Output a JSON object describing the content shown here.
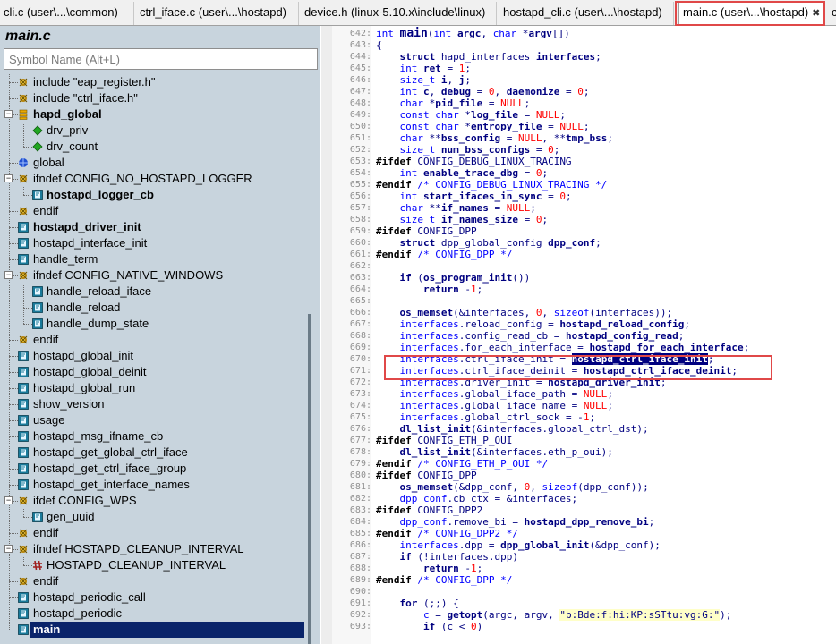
{
  "tabs": [
    {
      "label": "cli.c (user\\...\\common)",
      "active": false
    },
    {
      "label": "ctrl_iface.c (user\\...\\hostapd)",
      "active": false
    },
    {
      "label": "device.h (linux-5.10.x\\include\\linux)",
      "active": false
    },
    {
      "label": "hostapd_cli.c (user\\...\\hostapd)",
      "active": false
    },
    {
      "label": "main.c (user\\...\\hostapd)",
      "active": true
    },
    {
      "label": "c",
      "active": false
    }
  ],
  "tab_close_glyph": "✖",
  "symbol_panel": {
    "title": "main.c",
    "search_placeholder": "Symbol Name (Alt+L)",
    "items": [
      {
        "label": "include \"eap_register.h\"",
        "icon": "include-icon",
        "bold": false
      },
      {
        "label": "include \"ctrl_iface.h\"",
        "icon": "include-icon",
        "bold": false
      },
      {
        "label": "hapd_global",
        "icon": "struct-icon",
        "bold": true
      },
      {
        "label": "drv_priv",
        "icon": "member-icon",
        "bold": false
      },
      {
        "label": "drv_count",
        "icon": "member-icon",
        "bold": false
      },
      {
        "label": "global",
        "icon": "global-var-icon",
        "bold": false
      },
      {
        "label": "ifndef CONFIG_NO_HOSTAPD_LOGGER",
        "icon": "preprocessor-icon",
        "bold": false
      },
      {
        "label": "hostapd_logger_cb",
        "icon": "function-icon",
        "bold": true
      },
      {
        "label": "endif",
        "icon": "preprocessor-icon",
        "bold": false
      },
      {
        "label": "hostapd_driver_init",
        "icon": "function-icon",
        "bold": true
      },
      {
        "label": "hostapd_interface_init",
        "icon": "function-icon",
        "bold": false
      },
      {
        "label": "handle_term",
        "icon": "function-icon",
        "bold": false
      },
      {
        "label": "ifndef CONFIG_NATIVE_WINDOWS",
        "icon": "preprocessor-icon",
        "bold": false
      },
      {
        "label": "handle_reload_iface",
        "icon": "function-icon",
        "bold": false
      },
      {
        "label": "handle_reload",
        "icon": "function-icon",
        "bold": false
      },
      {
        "label": "handle_dump_state",
        "icon": "function-icon",
        "bold": false
      },
      {
        "label": "endif",
        "icon": "preprocessor-icon",
        "bold": false
      },
      {
        "label": "hostapd_global_init",
        "icon": "function-icon",
        "bold": false
      },
      {
        "label": "hostapd_global_deinit",
        "icon": "function-icon",
        "bold": false
      },
      {
        "label": "hostapd_global_run",
        "icon": "function-icon",
        "bold": false
      },
      {
        "label": "show_version",
        "icon": "function-icon",
        "bold": false
      },
      {
        "label": "usage",
        "icon": "function-icon",
        "bold": false
      },
      {
        "label": "hostapd_msg_ifname_cb",
        "icon": "function-icon",
        "bold": false
      },
      {
        "label": "hostapd_get_global_ctrl_iface",
        "icon": "function-icon",
        "bold": false
      },
      {
        "label": "hostapd_get_ctrl_iface_group",
        "icon": "function-icon",
        "bold": false
      },
      {
        "label": "hostapd_get_interface_names",
        "icon": "function-icon",
        "bold": false
      },
      {
        "label": "ifdef CONFIG_WPS",
        "icon": "preprocessor-icon",
        "bold": false
      },
      {
        "label": "gen_uuid",
        "icon": "function-icon",
        "bold": false
      },
      {
        "label": "endif",
        "icon": "preprocessor-icon",
        "bold": false
      },
      {
        "label": "ifndef HOSTAPD_CLEANUP_INTERVAL",
        "icon": "preprocessor-icon",
        "bold": false
      },
      {
        "label": "HOSTAPD_CLEANUP_INTERVAL",
        "icon": "macro-icon",
        "bold": false
      },
      {
        "label": "endif",
        "icon": "preprocessor-icon",
        "bold": false
      },
      {
        "label": "hostapd_periodic_call",
        "icon": "function-icon",
        "bold": false
      },
      {
        "label": "hostapd_periodic",
        "icon": "function-icon",
        "bold": false
      },
      {
        "label": "main",
        "icon": "function-icon",
        "bold": true,
        "selected": true
      }
    ]
  },
  "code": {
    "first_line_number": 642,
    "highlighted_line": 670,
    "selected_text": "hostapd_ctrl_iface_init"
  },
  "colors": {
    "panel_bg": "#c8d4dd",
    "selection_bg": "#0a246a",
    "keyword": "#0000ff",
    "identifier": "#000080",
    "number": "#ff0000",
    "annotation_red": "#e04848"
  }
}
